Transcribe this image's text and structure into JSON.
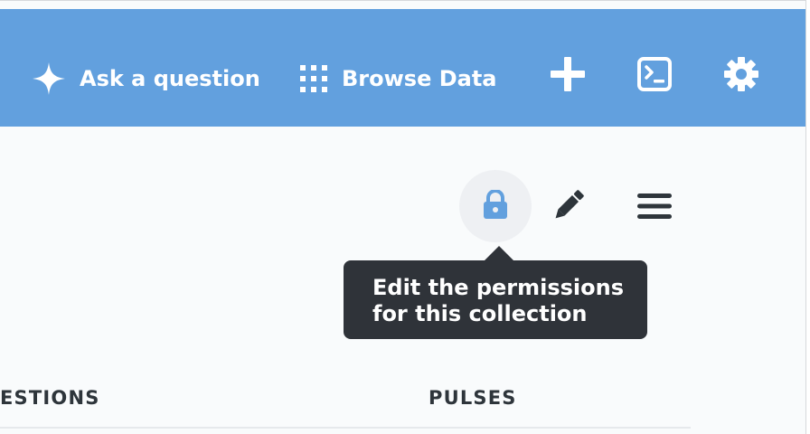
{
  "navbar": {
    "background": "#62a0de",
    "ask_label": "Ask a question",
    "ask_icon": "sparkle-icon",
    "browse_label": "Browse Data",
    "browse_icon": "grid-icon",
    "new_icon": "plus-icon",
    "sql_icon": "terminal-icon",
    "settings_icon": "gear-icon"
  },
  "collection_actions": {
    "permissions_icon": "lock-icon",
    "edit_icon": "pencil-icon",
    "menu_icon": "hamburger-menu-icon",
    "lock_color": "#62a0de"
  },
  "tooltip": {
    "line1": "Edit the permissions",
    "line2": "for this collection",
    "background": "#2f3339"
  },
  "table": {
    "headers": [
      "ESTIONS",
      "PULSES"
    ]
  }
}
